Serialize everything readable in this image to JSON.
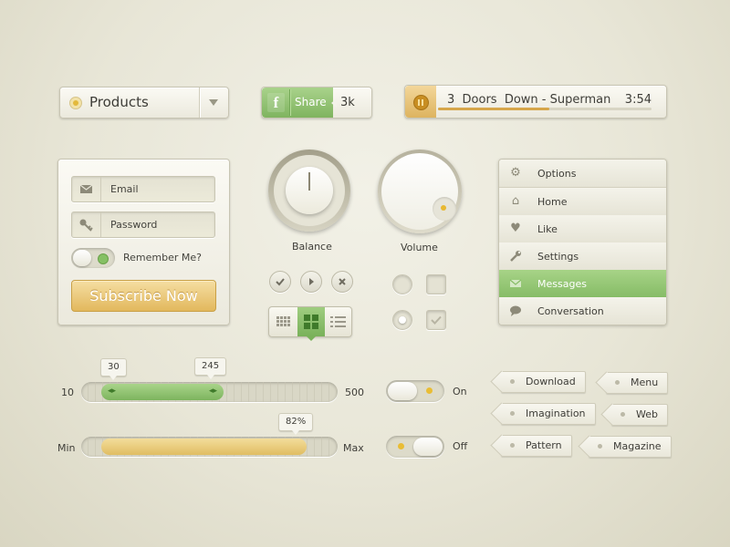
{
  "dropdown": {
    "label": "Products"
  },
  "share": {
    "icon": "f",
    "label": "Share",
    "count": "3k"
  },
  "player": {
    "title": "3  Doors  Down - Superman",
    "time": "3:54",
    "progress": 0.52
  },
  "login": {
    "email_label": "Email",
    "password_label": "Password",
    "remember_label": "Remember Me?",
    "subscribe_label": "Subscribe Now"
  },
  "knobs": {
    "balance_label": "Balance",
    "volume_label": "Volume"
  },
  "menu": {
    "header": "Options",
    "items": [
      {
        "label": "Home",
        "icon": "home-icon"
      },
      {
        "label": "Like",
        "icon": "heart-icon"
      },
      {
        "label": "Settings",
        "icon": "wrench-icon"
      },
      {
        "label": "Messages",
        "icon": "envelope-icon",
        "active": true
      },
      {
        "label": "Conversation",
        "icon": "chat-icon"
      }
    ]
  },
  "range_slider": {
    "min_label": "10",
    "max_label": "500",
    "low_value": "30",
    "high_value": "245"
  },
  "progress_slider": {
    "min_label": "Min",
    "max_label": "Max",
    "value": "82%"
  },
  "toggles": {
    "on_label": "On",
    "off_label": "Off"
  },
  "tags": [
    "Download",
    "Menu",
    "Imagination",
    "Web",
    "Pattern",
    "Magazine"
  ],
  "colors": {
    "accent_green": "#86bc66",
    "accent_gold": "#e2b85d",
    "background": "#e8e6d7"
  }
}
